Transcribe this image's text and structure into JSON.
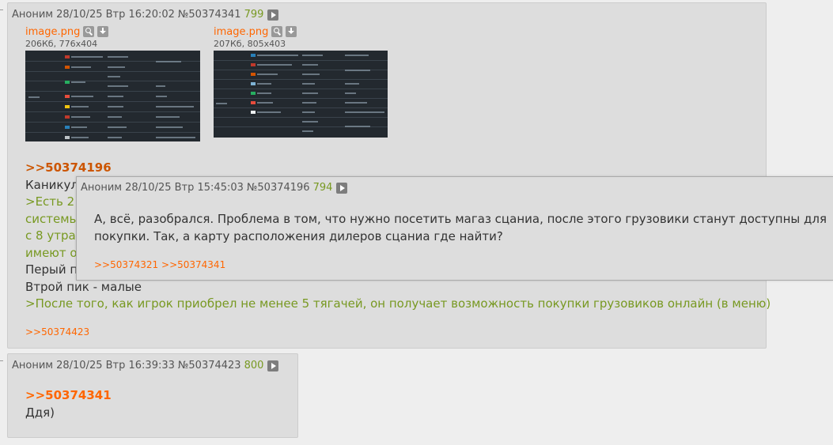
{
  "posts": [
    {
      "author": "Аноним",
      "datetime": "28/10/25 Втр 16:20:02",
      "number": "№50374341",
      "ordinal": "799",
      "files": [
        {
          "name": "image.png",
          "meta": "206Кб, 776x404"
        },
        {
          "name": "image.png",
          "meta": "207Кб, 805x403"
        }
      ],
      "body": {
        "reply_ref": ">>50374196",
        "line1": "Каникул",
        "quote1": ">Есть 2 т",
        "quote2": "системы",
        "quote3": "с 8 утра",
        "quote4": "имеют о",
        "line2": "Перый п",
        "line3": "Втрой пик - малые",
        "quote5": ">После того, как игрок приобрел не менее 5 тягачей, он получает возможность покупки грузовиков онлайн (в меню)"
      },
      "backlinks": [
        ">>50374423"
      ]
    },
    {
      "author": "Аноним",
      "datetime": "28/10/25 Втр 16:39:33",
      "number": "№50374423",
      "ordinal": "800",
      "body": {
        "reply_ref": ">>50374341",
        "line1": "Ддя)"
      }
    }
  ],
  "popup": {
    "author": "Аноним",
    "datetime": "28/10/25 Втр 15:45:03",
    "number": "№50374196",
    "ordinal": "794",
    "line1": "А, всё, разобрался. Проблема в том, что нужно посетить магаз сцаниа, после этого грузовики станут доступны для",
    "line2": "покупки. Так, а карту расположения дилеров сцаниа где найти?",
    "backlinks": [
      ">>50374321",
      ">>50374341"
    ]
  },
  "colors": {
    "background": "#eeeeee",
    "post_background": "#dddddd",
    "link": "#ff6600",
    "quote": "#789922",
    "thumbnail_background": "#23292f"
  },
  "icons": [
    "play-icon",
    "search-icon",
    "download-icon"
  ]
}
